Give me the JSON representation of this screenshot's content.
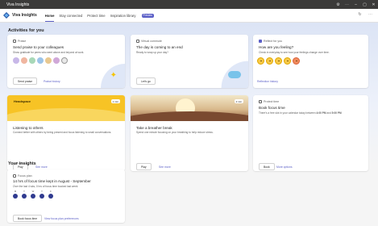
{
  "titlebar": {
    "title": "Viva Insights"
  },
  "header": {
    "app_name": "Viva Insights",
    "tabs": [
      "Home",
      "Stay connected",
      "Protect time",
      "Inspiration library"
    ],
    "badge": "Preview"
  },
  "activities": {
    "section_title": "Activities for you",
    "praise": {
      "label": "Praise",
      "title": "Send praise to your colleagues",
      "subtitle": "Show gratitude for peers who went above and beyond at work.",
      "primary_button": "Send praise",
      "link": "Praise history"
    },
    "virtual_commute": {
      "label": "Virtual commute",
      "title": "The day is coming to an end",
      "subtitle": "Ready to wrap up your day?",
      "primary_button": "Let's go"
    },
    "reflect": {
      "label": "Reflect for you",
      "title": "How are you feeling?",
      "subtitle": "Check in everyday to see how your feelings change over time.",
      "link": "Reflection history"
    },
    "headspace": {
      "brand": "Headspace",
      "time": "1 min",
      "title": "Listening to others",
      "subtitle": "Connect better with others by being present and focus listening to small conversations.",
      "primary_button": "Play",
      "link": "See more"
    },
    "breather": {
      "time": "2 min",
      "title": "Take a breather break",
      "subtitle": "Spend one minute focusing on your breathing to help reduce stress.",
      "primary_button": "Play",
      "link": "See more"
    },
    "protect_time": {
      "label": "Protect time",
      "title": "Book focus time",
      "subtitle_prefix": "There's a free slot in your calendar today between",
      "start": "4:00 PM",
      "joiner": "and",
      "end": "5:00 PM",
      "primary_button": "Book",
      "link": "More options"
    }
  },
  "insights": {
    "section_title": "Your insights",
    "focus_plan": {
      "label": "Focus plan",
      "title": "14 hrs of focus time kept in August - September",
      "subtitle": "Over the last 4 wks, 0 hrs of focus time booked last week",
      "days": [
        "M",
        "T",
        "W",
        "T",
        "F"
      ],
      "primary_button": "Book focus time",
      "link": "View focus plan preferences"
    }
  },
  "colors": {
    "accent": "#5b5fc7",
    "headspace_yellow": "#f7c325",
    "titlebar": "#3b3a39"
  }
}
